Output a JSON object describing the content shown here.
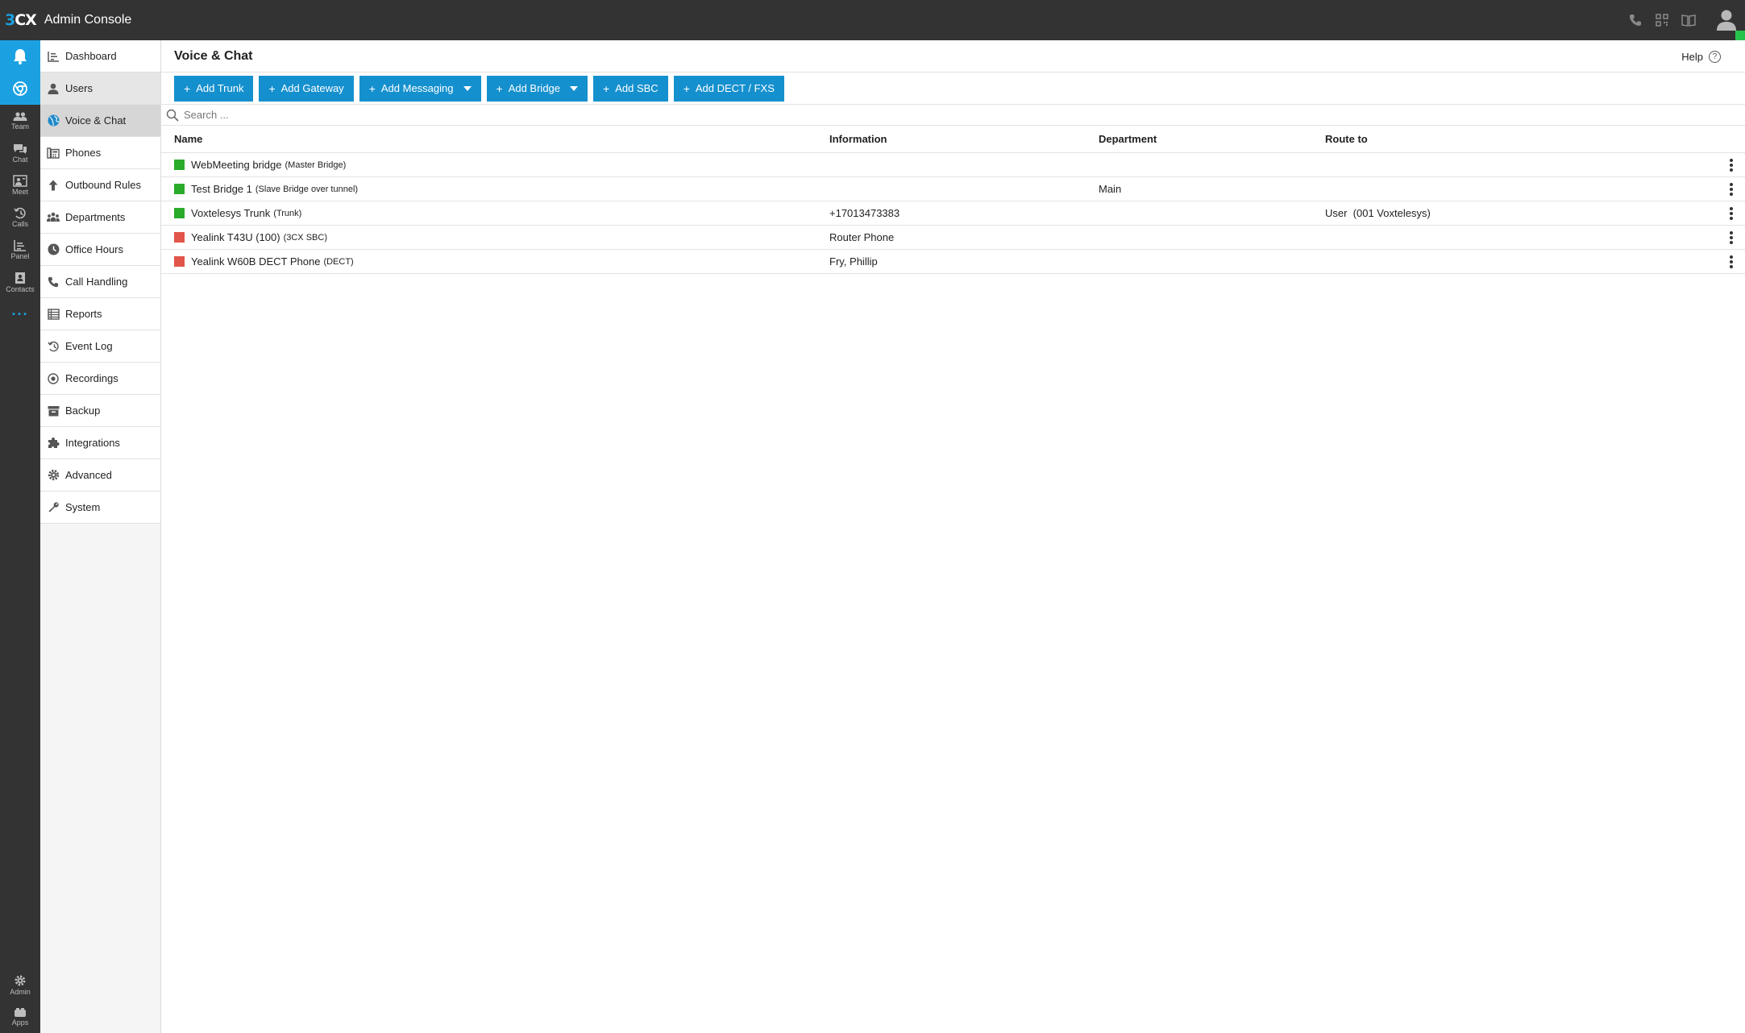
{
  "header": {
    "logo_text": "3CX",
    "logo_3": "3",
    "logo_cx": "CX",
    "app_title": "Admin Console",
    "icons": [
      "phone-icon",
      "qr-code-icon",
      "book-icon",
      "user-avatar-icon"
    ],
    "presence_color": "#27c24c"
  },
  "rail": {
    "items": [
      {
        "name": "notifications",
        "label": "",
        "icon": "bell-icon",
        "active": true
      },
      {
        "name": "chrome",
        "label": "",
        "icon": "chrome-icon",
        "active": true
      },
      {
        "name": "team",
        "label": "Team",
        "icon": "team-icon"
      },
      {
        "name": "chat",
        "label": "Chat",
        "icon": "chat-icon"
      },
      {
        "name": "meet",
        "label": "Meet",
        "icon": "meet-icon"
      },
      {
        "name": "calls",
        "label": "Calls",
        "icon": "calls-icon"
      },
      {
        "name": "panel",
        "label": "Panel",
        "icon": "panel-icon"
      },
      {
        "name": "contacts",
        "label": "Contacts",
        "icon": "contacts-icon"
      }
    ],
    "more": "···",
    "bottom": [
      {
        "name": "admin",
        "label": "Admin",
        "icon": "gear-icon"
      },
      {
        "name": "apps",
        "label": "Apps",
        "icon": "apps-icon"
      }
    ]
  },
  "nav": {
    "items": [
      {
        "label": "Dashboard",
        "icon": "dashboard-icon"
      },
      {
        "label": "Users",
        "icon": "user-icon"
      },
      {
        "label": "Voice & Chat",
        "icon": "globe-icon"
      },
      {
        "label": "Phones",
        "icon": "phones-icon"
      },
      {
        "label": "Outbound Rules",
        "icon": "arrow-up-icon"
      },
      {
        "label": "Departments",
        "icon": "departments-icon"
      },
      {
        "label": "Office Hours",
        "icon": "clock-icon"
      },
      {
        "label": "Call Handling",
        "icon": "phone-icon"
      },
      {
        "label": "Reports",
        "icon": "reports-icon"
      },
      {
        "label": "Event Log",
        "icon": "history-icon"
      },
      {
        "label": "Recordings",
        "icon": "record-icon"
      },
      {
        "label": "Backup",
        "icon": "archive-icon"
      },
      {
        "label": "Integrations",
        "icon": "puzzle-icon"
      },
      {
        "label": "Advanced",
        "icon": "gear-icon"
      },
      {
        "label": "System",
        "icon": "wrench-icon"
      }
    ]
  },
  "page": {
    "title": "Voice & Chat",
    "help_label": "Help",
    "help_icon": "?"
  },
  "toolbar": {
    "plus": "+",
    "buttons": [
      {
        "label": "Add Trunk",
        "dropdown": false
      },
      {
        "label": "Add Gateway",
        "dropdown": false
      },
      {
        "label": "Add Messaging",
        "dropdown": true
      },
      {
        "label": "Add Bridge",
        "dropdown": true
      },
      {
        "label": "Add SBC",
        "dropdown": false
      },
      {
        "label": "Add DECT / FXS",
        "dropdown": false
      }
    ],
    "accent": "#1590ce"
  },
  "search": {
    "placeholder": "Search ..."
  },
  "table": {
    "columns": [
      "Name",
      "Information",
      "Department",
      "Route to"
    ],
    "rows": [
      {
        "status": "green",
        "name": "WebMeeting bridge",
        "type": "(Master Bridge)",
        "info": "",
        "department": "",
        "route": ""
      },
      {
        "status": "green",
        "name": "Test Bridge 1",
        "type": "(Slave Bridge over tunnel)",
        "info": "",
        "department": "Main",
        "route": ""
      },
      {
        "status": "green",
        "name": "Voxtelesys Trunk",
        "type": "(Trunk)",
        "info": "+17013473383",
        "department": "",
        "route": "User  (001 Voxtelesys)"
      },
      {
        "status": "red",
        "name": "Yealink T43U (100)",
        "type": "(3CX SBC)",
        "info": "Router Phone",
        "department": "",
        "route": ""
      },
      {
        "status": "red",
        "name": "Yealink W60B DECT Phone",
        "type": "(DECT)",
        "info": "Fry, Phillip",
        "department": "",
        "route": ""
      }
    ],
    "status_colors": {
      "green": "#2bab2b",
      "red": "#e2554a"
    }
  }
}
